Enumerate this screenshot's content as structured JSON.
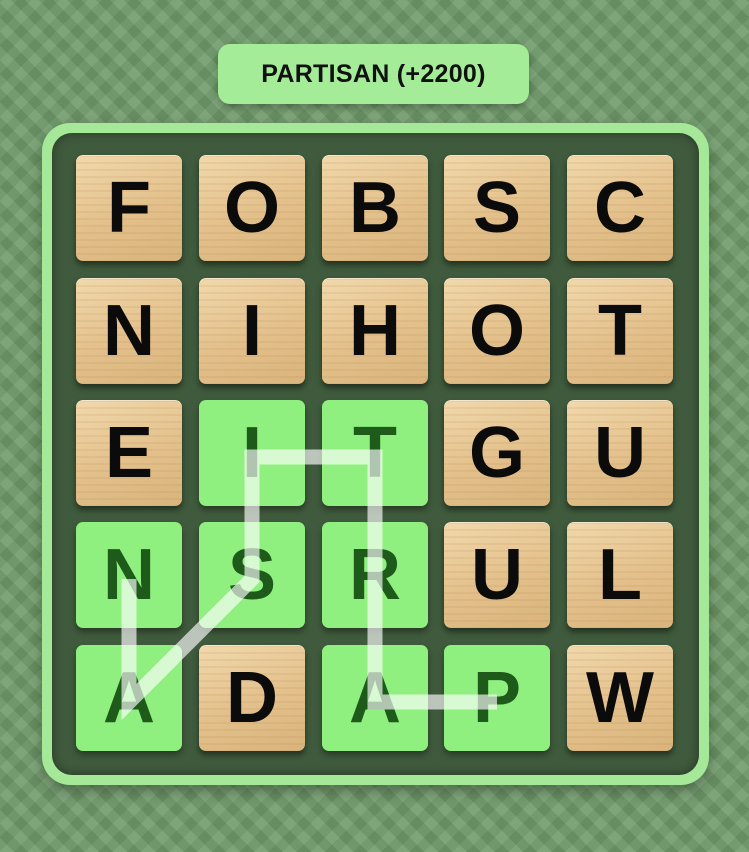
{
  "current_word": "PARTISAN (+2200)",
  "colors": {
    "background": "#6f9a6a",
    "board_frame": "#a4e898",
    "board_inner": "#3f5a3c",
    "selected_tile": "#8ff07f",
    "tile_wood": "#e3c08b"
  },
  "grid": [
    [
      "F",
      "O",
      "B",
      "S",
      "C"
    ],
    [
      "N",
      "I",
      "H",
      "O",
      "T"
    ],
    [
      "E",
      "I",
      "T",
      "G",
      "U"
    ],
    [
      "N",
      "S",
      "R",
      "U",
      "L"
    ],
    [
      "A",
      "D",
      "A",
      "P",
      "W"
    ]
  ],
  "selected_cells": [
    [
      2,
      1
    ],
    [
      2,
      2
    ],
    [
      3,
      0
    ],
    [
      3,
      1
    ],
    [
      3,
      2
    ],
    [
      4,
      0
    ],
    [
      4,
      2
    ],
    [
      4,
      3
    ]
  ],
  "selection_path_order": [
    [
      4,
      3
    ],
    [
      4,
      2
    ],
    [
      3,
      2
    ],
    [
      2,
      2
    ],
    [
      2,
      1
    ],
    [
      3,
      1
    ],
    [
      4,
      0
    ],
    [
      3,
      0
    ]
  ]
}
